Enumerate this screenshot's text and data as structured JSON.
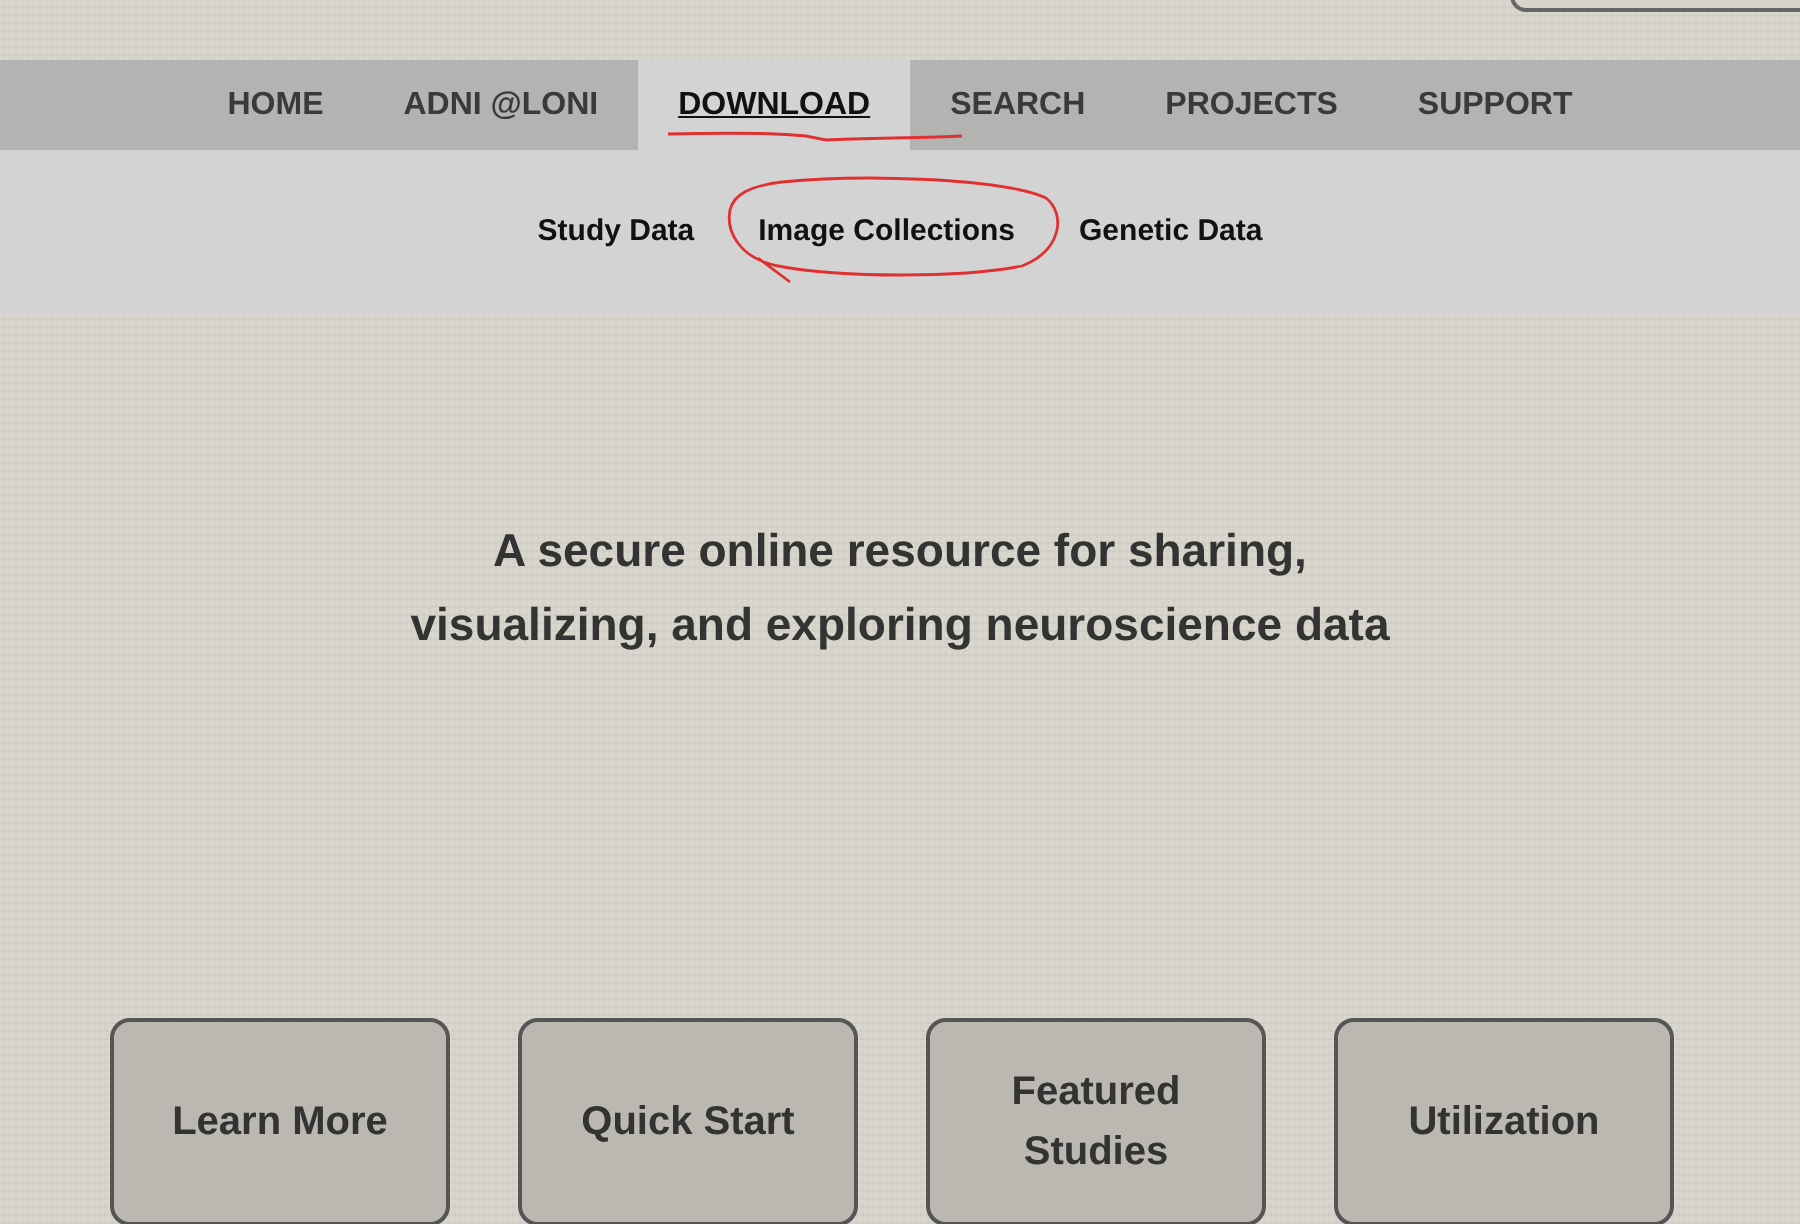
{
  "nav": [
    {
      "label": "HOME",
      "selected": false,
      "annotated": false
    },
    {
      "label": "ADNI @LONI",
      "selected": false,
      "annotated": false
    },
    {
      "label": "DOWNLOAD",
      "selected": true,
      "annotated": true
    },
    {
      "label": "SEARCH",
      "selected": false,
      "annotated": false
    },
    {
      "label": "PROJECTS",
      "selected": false,
      "annotated": false
    },
    {
      "label": "SUPPORT",
      "selected": false,
      "annotated": false
    }
  ],
  "subnav": [
    {
      "label": "Study Data",
      "annotated": false
    },
    {
      "label": "Image Collections",
      "annotated": true
    },
    {
      "label": "Genetic Data",
      "annotated": false
    }
  ],
  "headline": "A secure online resource for sharing, visualizing, and exploring neuroscience data",
  "cards": [
    "Learn More",
    "Quick Start",
    "Featured Studies",
    "Utilization"
  ]
}
